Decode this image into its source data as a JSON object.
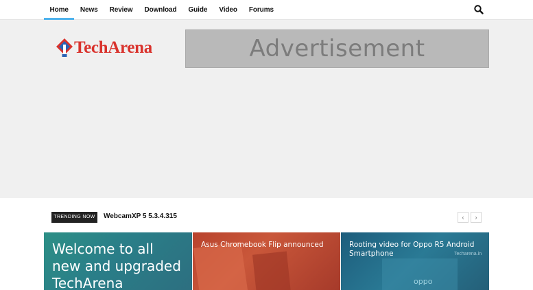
{
  "nav": {
    "items": [
      {
        "label": "Home",
        "active": true
      },
      {
        "label": "News",
        "active": false
      },
      {
        "label": "Review",
        "active": false
      },
      {
        "label": "Download",
        "active": false
      },
      {
        "label": "Guide",
        "active": false
      },
      {
        "label": "Video",
        "active": false
      },
      {
        "label": "Forums",
        "active": false
      }
    ],
    "search_icon": "search-icon"
  },
  "header": {
    "logo_text": "TechArena",
    "ad_text": "Advertisement"
  },
  "trending": {
    "badge": "TRENDING NOW",
    "title": "WebcamXP 5 5.3.4.315",
    "prev_icon": "chevron-left-icon",
    "next_icon": "chevron-right-icon"
  },
  "tiles": [
    {
      "title": "Welcome to all new and upgraded TechArena"
    },
    {
      "title": "Asus Chromebook Flip announced"
    },
    {
      "title": "Rooting video for Oppo R5 Android Smartphone",
      "watermark": "Techarena.in"
    }
  ],
  "colors": {
    "accent": "#4db2ec",
    "logo_red": "#d9322c",
    "logo_blue": "#2a63b5",
    "ad_bg": "#b9b9b9"
  }
}
